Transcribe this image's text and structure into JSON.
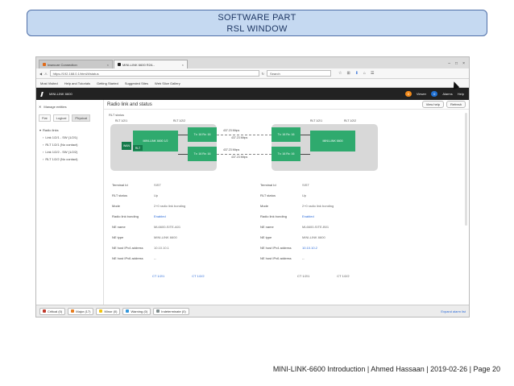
{
  "slide": {
    "title_line1": "SOFTWARE PART",
    "title_line2": "RSL WINDOW",
    "footer": "MINI-LINK-6600 Introduction | Ahmed Hassaan | 2019-02-26 | Page 20"
  },
  "browser": {
    "tabs": [
      {
        "label": "Insecure Connection",
        "close": "×"
      },
      {
        "label": "MINI-LINK 6600 R2A -",
        "close": "×"
      }
    ],
    "url": "https://192.168.0.1/html/#/status",
    "search_placeholder": "Search",
    "window_controls": [
      "–",
      "□",
      "×"
    ],
    "toolbar_icons": [
      "☆",
      "⊞",
      "⬇",
      "⌂",
      "☰"
    ],
    "bookmarks": [
      "Most Visited",
      "Help and Tutorials",
      "Getting Started",
      "Suggested Sites",
      "Web Slice Gallery"
    ]
  },
  "app": {
    "brand": "MINI-LINK 6600",
    "alarm_pill": "0",
    "alarm_label": "Viewer",
    "user_pill": "0",
    "user_label": "Alarms",
    "help_label": "Help"
  },
  "sidebar": {
    "title": "Manage entities",
    "tabs": [
      "Flat",
      "Logical",
      "Physical"
    ],
    "tree": [
      {
        "label": "Radio links",
        "root": true
      },
      {
        "label": "Link 1/2/1 - SW (1/2/1)"
      },
      {
        "label": "RLT 1/2/1 (No contact)"
      },
      {
        "label": "Link 1/2/2 - SW (1/2/2)"
      },
      {
        "label": "RLT 1/2/2 (No contact)"
      }
    ]
  },
  "main": {
    "header": "Radio link and status",
    "btn_help": "View help",
    "btn_refresh": "Refresh",
    "section": "RLT status",
    "diagram": {
      "left_port_top": "RLT 1/2/1",
      "left_port_bottom": "RLT 1/2/2",
      "right_port_top": "RLT 1/2/1",
      "right_port_bottom": "RLT 1/2/2",
      "left_main": "MINI-LINK 6600 1/2",
      "right_main": "MINI-LINK 6600",
      "wan": "WAN",
      "rlt": "RLT",
      "rf_left_top": "Tx: 16 Rx: 16",
      "rf_left_bottom": "Tx: 16 Rx: 16",
      "rf_right_top": "Tx: 16 Rx: 16",
      "rf_right_bottom": "Tx: 16 Rx: 16",
      "rate_top": "437.23 Mbps",
      "rate_top2": "437.23 Mbps",
      "rate_bottom": "437.23 Mbps",
      "rate_bottom2": "437.23 Mbps"
    },
    "left_props": [
      {
        "k": "Terminal Id",
        "v": "SIST"
      },
      {
        "k": "RLT status",
        "v": "Up"
      },
      {
        "k": "Mode",
        "v": "2+0 radio link bonding"
      },
      {
        "k": "Radio link bonding",
        "v": "Enabled",
        "link": true
      },
      {
        "k": "NE name",
        "v": "ML6600-SITE-A01"
      },
      {
        "k": "NE type",
        "v": "MINI-LINK 6600"
      },
      {
        "k": "NE host IPv4 address",
        "v": "10.10.10.1"
      },
      {
        "k": "NE host IPv6 address",
        "v": "--"
      }
    ],
    "right_props": [
      {
        "k": "Terminal Id",
        "v": "SIST"
      },
      {
        "k": "RLT status",
        "v": "Up"
      },
      {
        "k": "Mode",
        "v": "2+0 radio link bonding"
      },
      {
        "k": "Radio link bonding",
        "v": "Enabled",
        "link": true
      },
      {
        "k": "NE name",
        "v": "ML6600-SITE-B01"
      },
      {
        "k": "NE type",
        "v": "MINI-LINK 6600"
      },
      {
        "k": "NE host IPv4 address",
        "v": "10.10.10.2",
        "link": true
      },
      {
        "k": "NE host IPv6 address",
        "v": "--"
      }
    ],
    "port_links_left": [
      "CT 1/2/1",
      "CT 1/2/2"
    ],
    "port_links_right": [
      "CT 1/2/1",
      "CT 1/2/2"
    ]
  },
  "statusbar": {
    "items": [
      {
        "label": "Critical (0)",
        "color": "#c0392b"
      },
      {
        "label": "Major (17)",
        "color": "#e67e22"
      },
      {
        "label": "Minor (0)",
        "color": "#f1c40f"
      },
      {
        "label": "Warning (0)",
        "color": "#3498db"
      },
      {
        "label": "Indeterminate (0)",
        "color": "#7f8c8d"
      }
    ],
    "right": "Expand alarm list"
  }
}
